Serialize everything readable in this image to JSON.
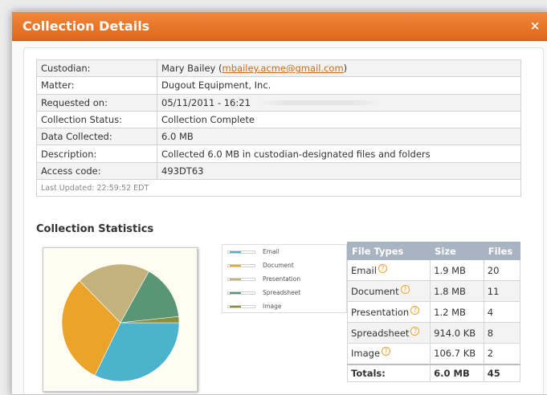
{
  "dialog": {
    "title": "Collection Details",
    "close_label": "×"
  },
  "details": {
    "custodian_label": "Custodian:",
    "custodian_name": "Mary Bailey (",
    "custodian_email": "mbailey.acme@gmail.com",
    "custodian_suffix": ")",
    "matter_label": "Matter:",
    "matter_value": "Dugout Equipment, Inc.",
    "requested_label": "Requested on:",
    "requested_value": "05/11/2011 - 16:21",
    "status_label": "Collection Status:",
    "status_value": "Collection Complete",
    "data_label": "Data Collected:",
    "data_value": "6.0 MB",
    "description_label": "Description:",
    "description_value": "Collected 6.0 MB in custodian-designated files and folders",
    "access_label": "Access code:",
    "access_value": "493DT63",
    "last_updated": "Last Updated: 22:59:52 EDT"
  },
  "statistics": {
    "section_title": "Collection Statistics",
    "headers": {
      "type": "File Types",
      "size": "Size",
      "files": "Files"
    },
    "rows": [
      {
        "type": "Email",
        "size": "1.9 MB",
        "files": "20"
      },
      {
        "type": "Document",
        "size": "1.8 MB",
        "files": "11"
      },
      {
        "type": "Presentation",
        "size": "1.2 MB",
        "files": "4"
      },
      {
        "type": "Spreadsheet",
        "size": "914.0 KB",
        "files": "8"
      },
      {
        "type": "Image",
        "size": "106.7 KB",
        "files": "2"
      }
    ],
    "totals": {
      "label": "Totals:",
      "size": "6.0 MB",
      "files": "45"
    },
    "help_icon": "?"
  },
  "legend": [
    "Email",
    "Document",
    "Presentation",
    "Spreadsheet",
    "Image"
  ],
  "colors": {
    "header_orange": "#e8741f",
    "email": "#4db3cc",
    "document": "#eba42a",
    "presentation": "#c4b27c",
    "spreadsheet": "#5a9673",
    "image": "#8a8f3c"
  },
  "chart_data": {
    "type": "pie",
    "labels": [
      "Email",
      "Document",
      "Presentation",
      "Spreadsheet",
      "Image"
    ],
    "values": [
      1.9,
      1.8,
      1.2,
      0.9,
      0.1
    ],
    "unit": "MB",
    "colors": [
      "#4db3cc",
      "#eba42a",
      "#c4b27c",
      "#5a9673",
      "#8a8f3c"
    ]
  }
}
